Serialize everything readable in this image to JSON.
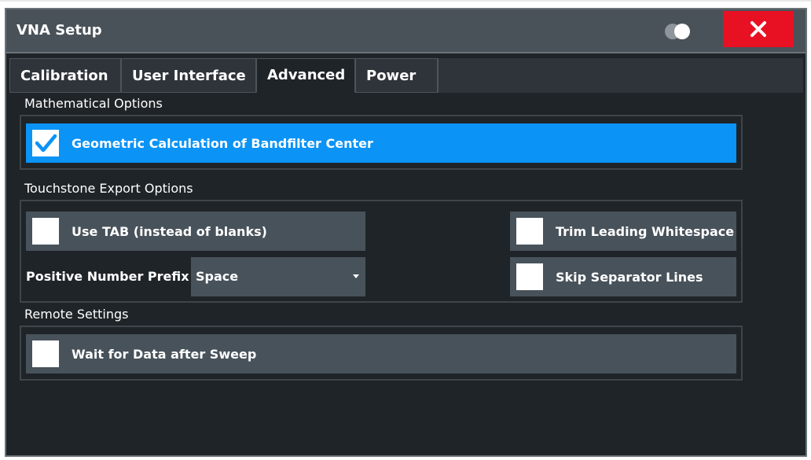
{
  "window": {
    "title": "VNA Setup"
  },
  "tabs": [
    {
      "label": "Calibration"
    },
    {
      "label": "User Interface"
    },
    {
      "label": "Advanced"
    },
    {
      "label": "Power"
    }
  ],
  "active_tab": "Advanced",
  "mathematical_options": {
    "title": "Mathematical Options",
    "geometric_calc": {
      "label": "Geometric Calculation of Bandfilter Center",
      "checked": true
    }
  },
  "touchstone_export": {
    "title": "Touchstone Export Options",
    "use_tab": {
      "label": "Use TAB (instead of blanks)",
      "checked": false
    },
    "trim_whitespace": {
      "label": "Trim Leading Whitespace",
      "checked": false
    },
    "skip_separator": {
      "label": "Skip Separator Lines",
      "checked": false
    },
    "positive_prefix": {
      "label": "Positive Number Prefix",
      "value": "Space"
    }
  },
  "remote_settings": {
    "title": "Remote Settings",
    "wait_for_data": {
      "label": "Wait for Data after Sweep",
      "checked": false
    }
  },
  "colors": {
    "selected_row": "#0b93f6",
    "row": "#48525b",
    "background": "#1f2428",
    "close_button": "#e81123"
  }
}
